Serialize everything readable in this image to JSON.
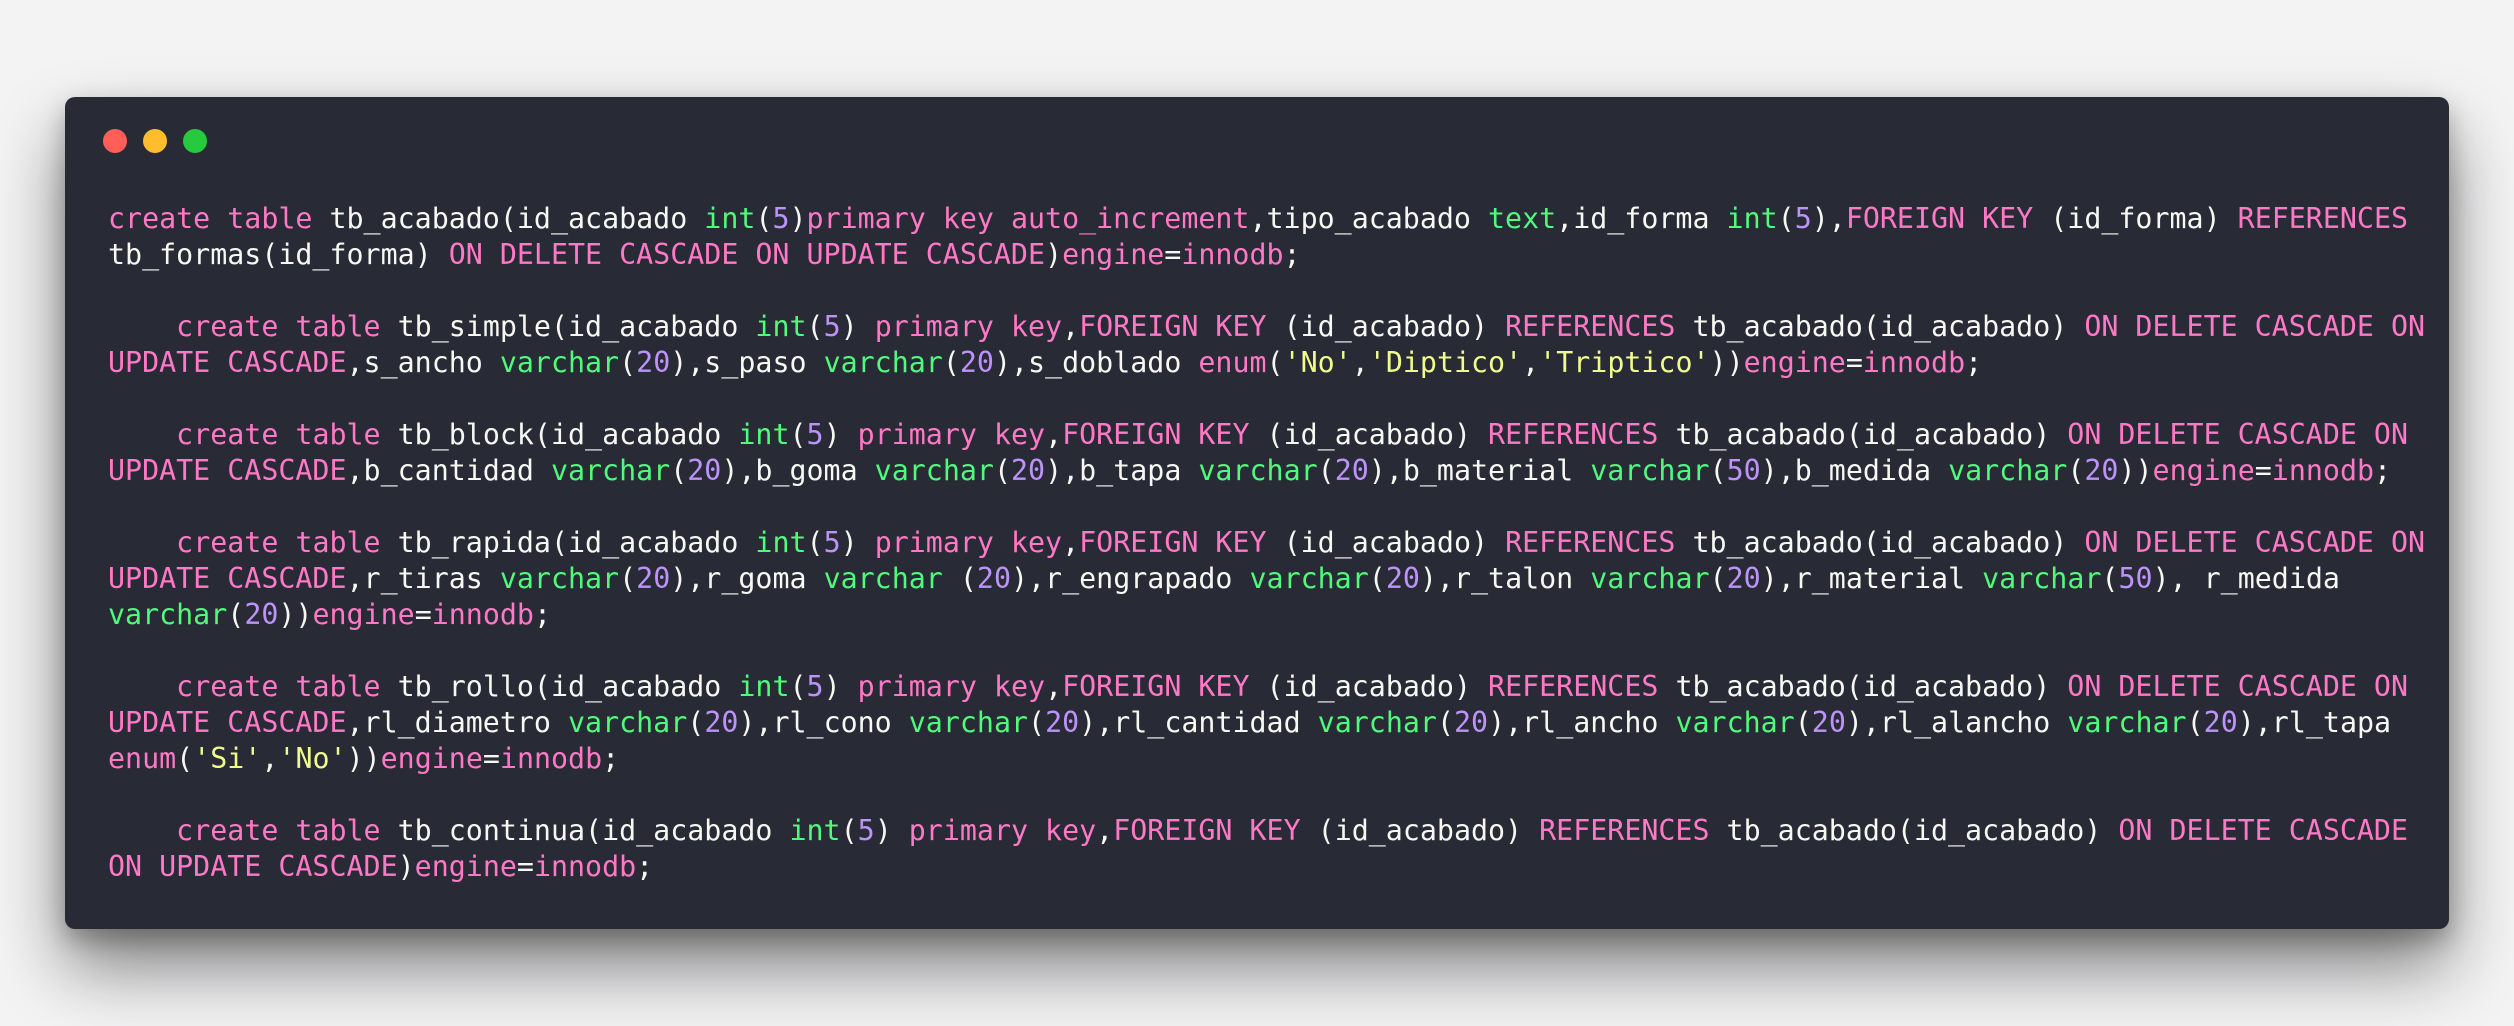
{
  "colors": {
    "background": "#f3f3f4",
    "window": "#282a36",
    "keyword": "#ff79c6",
    "type": "#50fa7b",
    "number": "#bd93f9",
    "string": "#f1fa8c",
    "plain": "#f8f8f2",
    "dot_close": "#ff5f56",
    "dot_minimize": "#ffbd2e",
    "dot_maximize": "#27c93f"
  },
  "code_lines": [
    [
      [
        "k",
        "create table "
      ],
      [
        "p",
        "tb_acabado(id_acabado "
      ],
      [
        "t",
        "int"
      ],
      [
        "p",
        "("
      ],
      [
        "n",
        "5"
      ],
      [
        "p",
        ")"
      ],
      [
        "k",
        "primary key auto_increment"
      ],
      [
        "p",
        ",tipo_acabado "
      ],
      [
        "t",
        "text"
      ],
      [
        "p",
        ",id_forma "
      ],
      [
        "t",
        "int"
      ],
      [
        "p",
        "("
      ],
      [
        "n",
        "5"
      ],
      [
        "p",
        "),"
      ],
      [
        "k",
        "FOREIGN KEY"
      ],
      [
        "p",
        " (id_forma) "
      ],
      [
        "k",
        "REFERENCES"
      ]
    ],
    [
      [
        "p",
        "tb_formas(id_forma) "
      ],
      [
        "k",
        "ON DELETE CASCADE ON UPDATE CASCADE"
      ],
      [
        "p",
        ")"
      ],
      [
        "k",
        "engine"
      ],
      [
        "p",
        "="
      ],
      [
        "k",
        "innodb"
      ],
      [
        "p",
        ";"
      ]
    ],
    [],
    [
      [
        "p",
        "    "
      ],
      [
        "k",
        "create table "
      ],
      [
        "p",
        "tb_simple(id_acabado "
      ],
      [
        "t",
        "int"
      ],
      [
        "p",
        "("
      ],
      [
        "n",
        "5"
      ],
      [
        "p",
        ") "
      ],
      [
        "k",
        "primary key"
      ],
      [
        "p",
        ","
      ],
      [
        "k",
        "FOREIGN KEY"
      ],
      [
        "p",
        " (id_acabado) "
      ],
      [
        "k",
        "REFERENCES"
      ],
      [
        "p",
        " tb_acabado(id_acabado) "
      ],
      [
        "k",
        "ON DELETE CASCADE ON"
      ]
    ],
    [
      [
        "k",
        "UPDATE CASCADE"
      ],
      [
        "p",
        ",s_ancho "
      ],
      [
        "t",
        "varchar"
      ],
      [
        "p",
        "("
      ],
      [
        "n",
        "20"
      ],
      [
        "p",
        "),s_paso "
      ],
      [
        "t",
        "varchar"
      ],
      [
        "p",
        "("
      ],
      [
        "n",
        "20"
      ],
      [
        "p",
        "),s_doblado "
      ],
      [
        "k",
        "enum"
      ],
      [
        "p",
        "("
      ],
      [
        "s",
        "'No'"
      ],
      [
        "p",
        ","
      ],
      [
        "s",
        "'Diptico'"
      ],
      [
        "p",
        ","
      ],
      [
        "s",
        "'Triptico'"
      ],
      [
        "p",
        "))"
      ],
      [
        "k",
        "engine"
      ],
      [
        "p",
        "="
      ],
      [
        "k",
        "innodb"
      ],
      [
        "p",
        ";"
      ]
    ],
    [],
    [
      [
        "p",
        "    "
      ],
      [
        "k",
        "create table "
      ],
      [
        "p",
        "tb_block(id_acabado "
      ],
      [
        "t",
        "int"
      ],
      [
        "p",
        "("
      ],
      [
        "n",
        "5"
      ],
      [
        "p",
        ") "
      ],
      [
        "k",
        "primary key"
      ],
      [
        "p",
        ","
      ],
      [
        "k",
        "FOREIGN KEY"
      ],
      [
        "p",
        " (id_acabado) "
      ],
      [
        "k",
        "REFERENCES"
      ],
      [
        "p",
        " tb_acabado(id_acabado) "
      ],
      [
        "k",
        "ON DELETE CASCADE ON"
      ]
    ],
    [
      [
        "k",
        "UPDATE CASCADE"
      ],
      [
        "p",
        ",b_cantidad "
      ],
      [
        "t",
        "varchar"
      ],
      [
        "p",
        "("
      ],
      [
        "n",
        "20"
      ],
      [
        "p",
        "),b_goma "
      ],
      [
        "t",
        "varchar"
      ],
      [
        "p",
        "("
      ],
      [
        "n",
        "20"
      ],
      [
        "p",
        "),b_tapa "
      ],
      [
        "t",
        "varchar"
      ],
      [
        "p",
        "("
      ],
      [
        "n",
        "20"
      ],
      [
        "p",
        "),b_material "
      ],
      [
        "t",
        "varchar"
      ],
      [
        "p",
        "("
      ],
      [
        "n",
        "50"
      ],
      [
        "p",
        "),b_medida "
      ],
      [
        "t",
        "varchar"
      ],
      [
        "p",
        "("
      ],
      [
        "n",
        "20"
      ],
      [
        "p",
        "))"
      ],
      [
        "k",
        "engine"
      ],
      [
        "p",
        "="
      ],
      [
        "k",
        "innodb"
      ],
      [
        "p",
        ";"
      ]
    ],
    [],
    [
      [
        "p",
        "    "
      ],
      [
        "k",
        "create table "
      ],
      [
        "p",
        "tb_rapida(id_acabado "
      ],
      [
        "t",
        "int"
      ],
      [
        "p",
        "("
      ],
      [
        "n",
        "5"
      ],
      [
        "p",
        ") "
      ],
      [
        "k",
        "primary key"
      ],
      [
        "p",
        ","
      ],
      [
        "k",
        "FOREIGN KEY"
      ],
      [
        "p",
        " (id_acabado) "
      ],
      [
        "k",
        "REFERENCES"
      ],
      [
        "p",
        " tb_acabado(id_acabado) "
      ],
      [
        "k",
        "ON DELETE CASCADE ON"
      ]
    ],
    [
      [
        "k",
        "UPDATE CASCADE"
      ],
      [
        "p",
        ",r_tiras "
      ],
      [
        "t",
        "varchar"
      ],
      [
        "p",
        "("
      ],
      [
        "n",
        "20"
      ],
      [
        "p",
        "),r_goma "
      ],
      [
        "t",
        "varchar"
      ],
      [
        "p",
        " ("
      ],
      [
        "n",
        "20"
      ],
      [
        "p",
        "),r_engrapado "
      ],
      [
        "t",
        "varchar"
      ],
      [
        "p",
        "("
      ],
      [
        "n",
        "20"
      ],
      [
        "p",
        "),r_talon "
      ],
      [
        "t",
        "varchar"
      ],
      [
        "p",
        "("
      ],
      [
        "n",
        "20"
      ],
      [
        "p",
        "),r_material "
      ],
      [
        "t",
        "varchar"
      ],
      [
        "p",
        "("
      ],
      [
        "n",
        "50"
      ],
      [
        "p",
        "), r_medida"
      ]
    ],
    [
      [
        "t",
        "varchar"
      ],
      [
        "p",
        "("
      ],
      [
        "n",
        "20"
      ],
      [
        "p",
        "))"
      ],
      [
        "k",
        "engine"
      ],
      [
        "p",
        "="
      ],
      [
        "k",
        "innodb"
      ],
      [
        "p",
        ";"
      ]
    ],
    [],
    [
      [
        "p",
        "    "
      ],
      [
        "k",
        "create table "
      ],
      [
        "p",
        "tb_rollo(id_acabado "
      ],
      [
        "t",
        "int"
      ],
      [
        "p",
        "("
      ],
      [
        "n",
        "5"
      ],
      [
        "p",
        ") "
      ],
      [
        "k",
        "primary key"
      ],
      [
        "p",
        ","
      ],
      [
        "k",
        "FOREIGN KEY"
      ],
      [
        "p",
        " (id_acabado) "
      ],
      [
        "k",
        "REFERENCES"
      ],
      [
        "p",
        " tb_acabado(id_acabado) "
      ],
      [
        "k",
        "ON DELETE CASCADE ON"
      ]
    ],
    [
      [
        "k",
        "UPDATE CASCADE"
      ],
      [
        "p",
        ",rl_diametro "
      ],
      [
        "t",
        "varchar"
      ],
      [
        "p",
        "("
      ],
      [
        "n",
        "20"
      ],
      [
        "p",
        "),rl_cono "
      ],
      [
        "t",
        "varchar"
      ],
      [
        "p",
        "("
      ],
      [
        "n",
        "20"
      ],
      [
        "p",
        "),rl_cantidad "
      ],
      [
        "t",
        "varchar"
      ],
      [
        "p",
        "("
      ],
      [
        "n",
        "20"
      ],
      [
        "p",
        "),rl_ancho "
      ],
      [
        "t",
        "varchar"
      ],
      [
        "p",
        "("
      ],
      [
        "n",
        "20"
      ],
      [
        "p",
        "),rl_alancho "
      ],
      [
        "t",
        "varchar"
      ],
      [
        "p",
        "("
      ],
      [
        "n",
        "20"
      ],
      [
        "p",
        "),rl_tapa"
      ]
    ],
    [
      [
        "k",
        "enum"
      ],
      [
        "p",
        "("
      ],
      [
        "s",
        "'Si'"
      ],
      [
        "p",
        ","
      ],
      [
        "s",
        "'No'"
      ],
      [
        "p",
        "))"
      ],
      [
        "k",
        "engine"
      ],
      [
        "p",
        "="
      ],
      [
        "k",
        "innodb"
      ],
      [
        "p",
        ";"
      ]
    ],
    [],
    [
      [
        "p",
        "    "
      ],
      [
        "k",
        "create table "
      ],
      [
        "p",
        "tb_continua(id_acabado "
      ],
      [
        "t",
        "int"
      ],
      [
        "p",
        "("
      ],
      [
        "n",
        "5"
      ],
      [
        "p",
        ") "
      ],
      [
        "k",
        "primary key"
      ],
      [
        "p",
        ","
      ],
      [
        "k",
        "FOREIGN KEY"
      ],
      [
        "p",
        " (id_acabado) "
      ],
      [
        "k",
        "REFERENCES"
      ],
      [
        "p",
        " tb_acabado(id_acabado) "
      ],
      [
        "k",
        "ON DELETE CASCADE"
      ]
    ],
    [
      [
        "k",
        "ON UPDATE CASCADE"
      ],
      [
        "p",
        ")"
      ],
      [
        "k",
        "engine"
      ],
      [
        "p",
        "="
      ],
      [
        "k",
        "innodb"
      ],
      [
        "p",
        ";"
      ]
    ]
  ]
}
